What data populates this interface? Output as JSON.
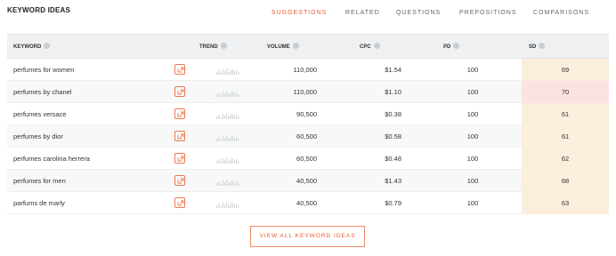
{
  "title": "KEYWORD IDEAS",
  "nav": [
    {
      "label": "SUGGESTIONS",
      "active": true
    },
    {
      "label": "RELATED",
      "active": false
    },
    {
      "label": "QUESTIONS",
      "active": false
    },
    {
      "label": "PREPOSITIONS",
      "active": false
    },
    {
      "label": "COMPARISONS",
      "active": false
    }
  ],
  "columns": [
    "KEYWORD",
    "TREND",
    "VOLUME",
    "CPC",
    "PD",
    "SD"
  ],
  "rows": [
    {
      "keyword": "perfumes for women",
      "volume": "110,000",
      "cpc": "$1.54",
      "pd": "100",
      "sd": "69",
      "sd_color": "#fbeedd"
    },
    {
      "keyword": "perfumes by chanel",
      "volume": "110,000",
      "cpc": "$1.10",
      "pd": "100",
      "sd": "70",
      "sd_color": "#fbe3e1"
    },
    {
      "keyword": "perfumes versace",
      "volume": "90,500",
      "cpc": "$0.38",
      "pd": "100",
      "sd": "61",
      "sd_color": "#fbeedd"
    },
    {
      "keyword": "perfumes by dior",
      "volume": "60,500",
      "cpc": "$0.58",
      "pd": "100",
      "sd": "61",
      "sd_color": "#fbeedd"
    },
    {
      "keyword": "perfumes carolina herrera",
      "volume": "60,500",
      "cpc": "$0.48",
      "pd": "100",
      "sd": "62",
      "sd_color": "#fbeedd"
    },
    {
      "keyword": "perfumes for men",
      "volume": "40,500",
      "cpc": "$1.43",
      "pd": "100",
      "sd": "68",
      "sd_color": "#fbeedd"
    },
    {
      "keyword": "parfums de marly",
      "volume": "40,500",
      "cpc": "$0.79",
      "pd": "100",
      "sd": "63",
      "sd_color": "#fbeedd"
    }
  ],
  "view_all_label": "VIEW ALL KEYWORD IDEAS",
  "colors": {
    "accent": "#ee5a2f",
    "sd_high": "#fbe3e1",
    "sd_medium": "#fbeedd"
  },
  "icons": {
    "external_link": "external-link-icon",
    "info": "info-icon",
    "trend": "trend-sparkline-icon"
  }
}
